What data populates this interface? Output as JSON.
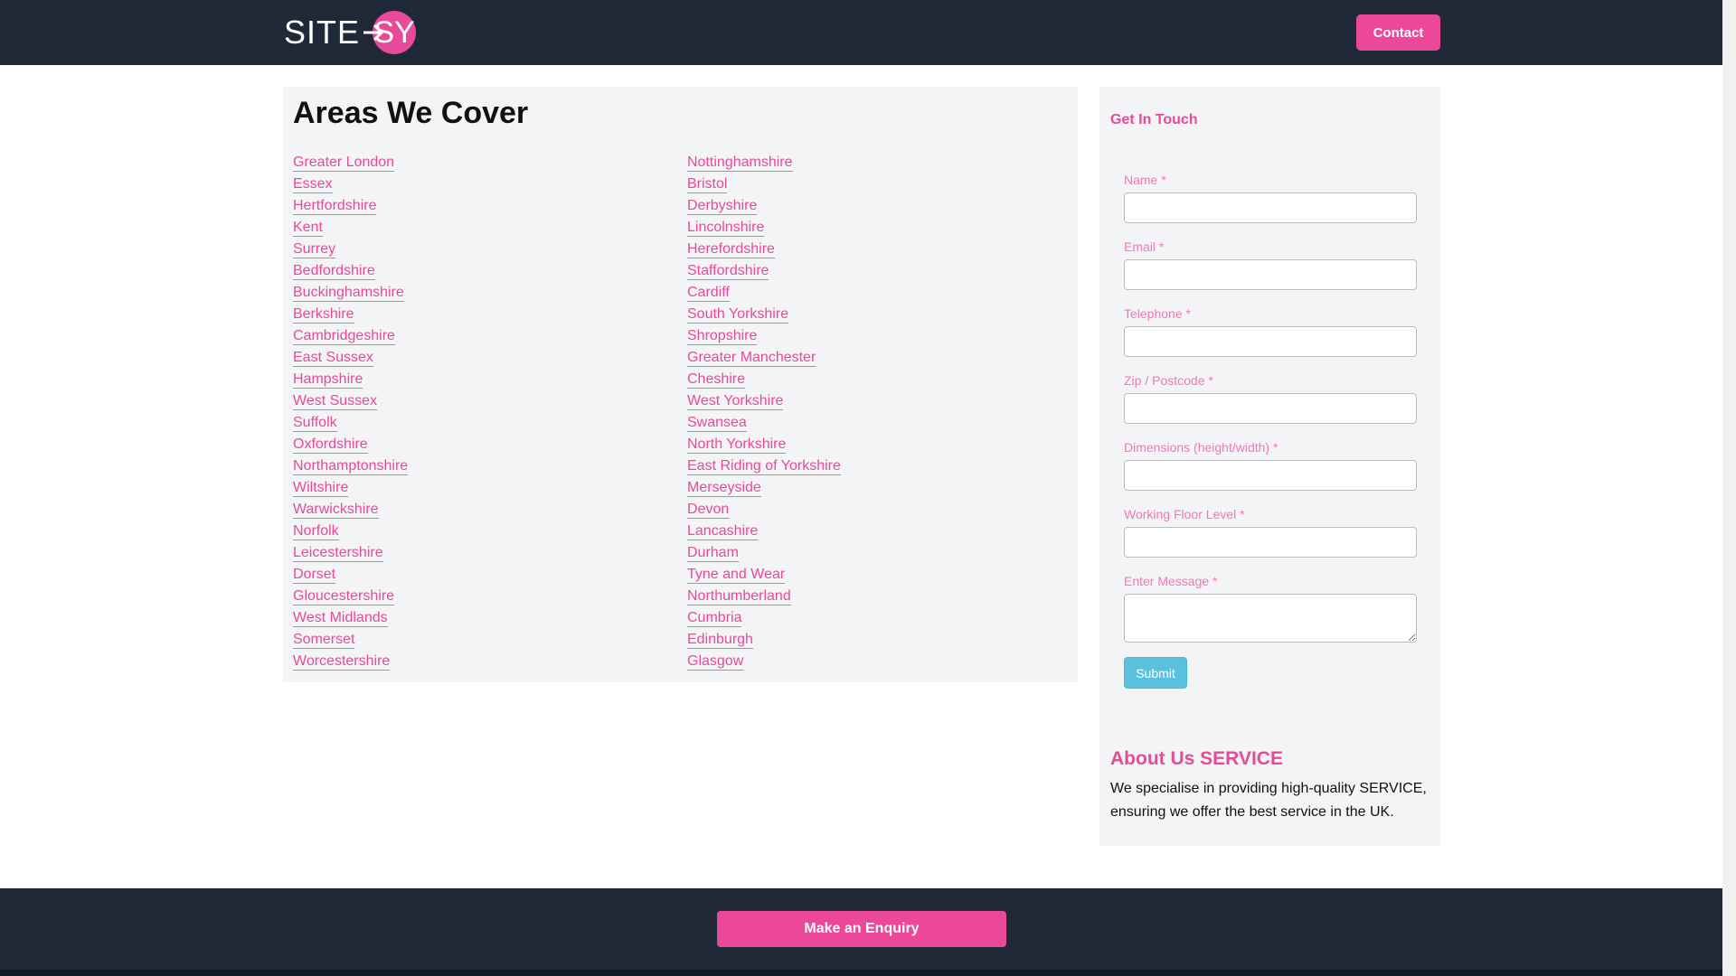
{
  "header": {
    "logo_text": "SITE",
    "logo_circle_text": "SY",
    "contact_label": "Contact"
  },
  "areas": {
    "title": "Areas We Cover",
    "left": [
      "Greater London",
      "Essex",
      "Hertfordshire",
      "Kent",
      "Surrey",
      "Bedfordshire",
      "Buckinghamshire",
      "Berkshire",
      "Cambridgeshire",
      "East Sussex",
      "Hampshire",
      "West Sussex",
      "Suffolk",
      "Oxfordshire",
      "Northamptonshire",
      "Wiltshire",
      "Warwickshire",
      "Norfolk",
      "Leicestershire",
      "Dorset",
      "Gloucestershire",
      "West Midlands",
      "Somerset",
      "Worcestershire"
    ],
    "right": [
      "Nottinghamshire",
      "Bristol",
      "Derbyshire",
      "Lincolnshire",
      "Herefordshire",
      "Staffordshire",
      "Cardiff",
      "South Yorkshire",
      "Shropshire",
      "Greater Manchester",
      "Cheshire",
      "West Yorkshire",
      "Swansea",
      "North Yorkshire",
      "East Riding of Yorkshire",
      "Merseyside",
      "Devon",
      "Lancashire",
      "Durham",
      "Tyne and Wear",
      "Northumberland",
      "Cumbria",
      "Edinburgh",
      "Glasgow"
    ]
  },
  "form": {
    "title": "Get In Touch",
    "fields": {
      "name": "Name *",
      "email": "Email *",
      "telephone": "Telephone *",
      "postcode": "Zip / Postcode *",
      "dimensions": "Dimensions (height/width) *",
      "floor": "Working Floor Level *",
      "message": "Enter Message *"
    },
    "submit_label": "Submit"
  },
  "about": {
    "title": "About Us SERVICE",
    "text": "We specialise in providing high-quality SERVICE, ensuring we offer the best service in the UK."
  },
  "footer": {
    "enquiry_label": "Make an Enquiry"
  },
  "colors": {
    "accent": "#ec4899",
    "nav_bg": "#1f2937",
    "panel_bg": "#f3f4f6",
    "submit": "#5bc0de"
  }
}
